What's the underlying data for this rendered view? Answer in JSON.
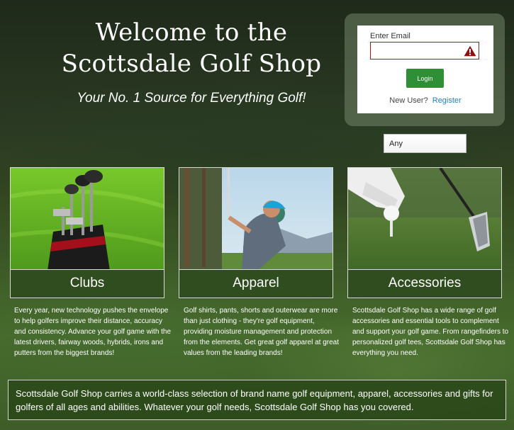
{
  "hero": {
    "title_line1": "Welcome to the",
    "title_line2": "Scottsdale Golf Shop",
    "subtitle": "Your No. 1 Source for Everything Golf!"
  },
  "login": {
    "email_label": "Enter Email",
    "email_value": "",
    "email_state": "invalid",
    "warning_icon": "warning-triangle-icon",
    "button_label": "Login",
    "new_user_text": "New User?",
    "register_link": "Register"
  },
  "filter": {
    "selected": "Any"
  },
  "cards": [
    {
      "title": "Clubs",
      "image": "golf-bag-with-clubs",
      "description": "Every year, new technology pushes the envelope to help golfers improve their distance, accuracy and consistency. Advance your golf game with the latest drivers, fairway woods, hybrids, irons and putters from the biggest brands!"
    },
    {
      "title": "Apparel",
      "image": "golfer-in-blue-cap-swinging",
      "description": "Golf shirts, pants, shorts and outerwear are more than just clothing - they're golf equipment, providing moisture management and protection from the elements. Get great golf apparel at great values from the leading brands!"
    },
    {
      "title": "Accessories",
      "image": "gloved-hand-placing-ball-on-tee",
      "description": "Scottsdale Golf Shop has a wide range of golf accessories and essential tools to complement and support your golf game. From rangefinders to personalized golf tees, Scottsdale Golf Shop has everything you need."
    }
  ],
  "footer": {
    "text": "Scottsdale Golf Shop carries a world-class selection of brand name golf equipment, apparel, accessories and gifts for golfers of all ages and abilities. Whatever your golf needs, Scottsdale Golf Shop has you covered."
  },
  "colors": {
    "primary_button": "#2e8f37",
    "card_label_bg": "#2f4d1e",
    "error_border": "#a01a1a",
    "link": "#1d7fc4"
  }
}
